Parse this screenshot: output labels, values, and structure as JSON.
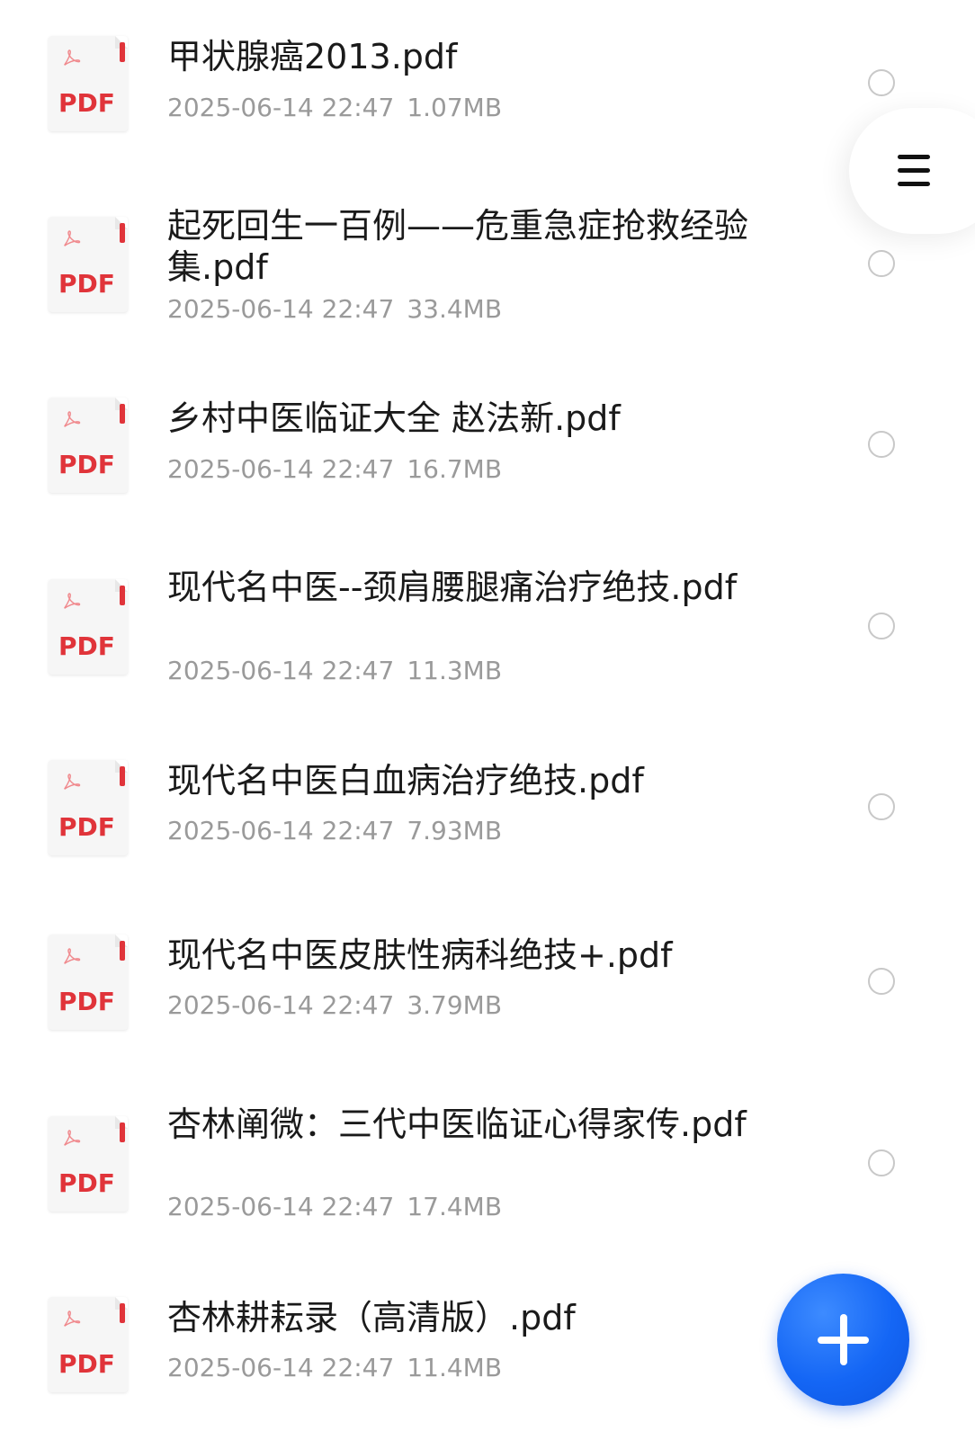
{
  "files": [
    {
      "name": "甲状腺癌2013.pdf",
      "date": "2025-06-14 22:47",
      "size": "1.07MB",
      "icon_label": "PDF",
      "selected": false
    },
    {
      "name": "起死回生一百例——危重急症抢救经验集.pdf",
      "date": "2025-06-14 22:47",
      "size": "33.4MB",
      "icon_label": "PDF",
      "selected": false
    },
    {
      "name": "乡村中医临证大全 赵法新.pdf",
      "date": "2025-06-14 22:47",
      "size": "16.7MB",
      "icon_label": "PDF",
      "selected": false
    },
    {
      "name": "现代名中医--颈肩腰腿痛治疗绝技.pdf",
      "date": "2025-06-14 22:47",
      "size": "11.3MB",
      "icon_label": "PDF",
      "selected": false
    },
    {
      "name": "现代名中医白血病治疗绝技.pdf",
      "date": "2025-06-14 22:47",
      "size": "7.93MB",
      "icon_label": "PDF",
      "selected": false
    },
    {
      "name": "现代名中医皮肤性病科绝技+.pdf",
      "date": "2025-06-14 22:47",
      "size": "3.79MB",
      "icon_label": "PDF",
      "selected": false
    },
    {
      "name": "杏林阐微：三代中医临证心得家传.pdf",
      "date": "2025-06-14 22:47",
      "size": "17.4MB",
      "icon_label": "PDF",
      "selected": false
    },
    {
      "name": "杏林耕耘录（高清版）.pdf",
      "date": "2025-06-14 22:47",
      "size": "11.4MB",
      "icon_label": "PDF",
      "selected": false
    }
  ],
  "icons": {
    "file_type": "pdf-file-icon",
    "menu": "hamburger-menu-icon",
    "fab": "plus-icon"
  },
  "colors": {
    "pdf_red": "#e0343a",
    "fab_blue": "#1466f5",
    "meta_gray": "#9a9a9a",
    "title_text": "#1a1a1a"
  }
}
